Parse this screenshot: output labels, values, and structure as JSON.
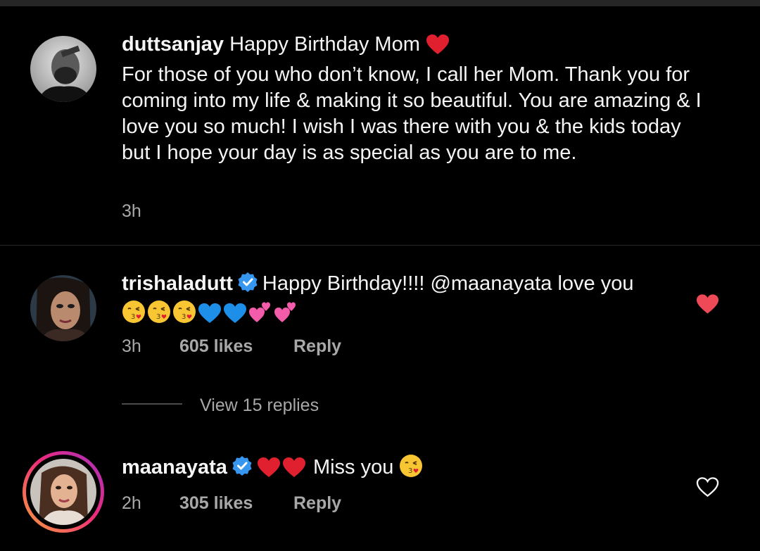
{
  "comments": [
    {
      "username": "duttsanjay",
      "text_first": "Happy Birthday Mom",
      "text_rest": "For those of you who don’t know, I call her Mom. Thank you for coming into my life & making it so beautiful. You are amazing & I love you so much! I wish I was there with you & the kids today but I hope your day is as special as you are to me.",
      "time": "3h",
      "verified": false
    },
    {
      "username": "trishaladutt",
      "text": "Happy Birthday!!!! @maanayata love you",
      "time": "3h",
      "likes": "605 likes",
      "reply_label": "Reply",
      "liked": true,
      "verified": true,
      "view_replies": "View 15 replies"
    },
    {
      "username": "maanayata",
      "text": "Miss you",
      "time": "2h",
      "likes": "305 likes",
      "reply_label": "Reply",
      "liked": false,
      "verified": true
    }
  ],
  "colors": {
    "background": "#000000",
    "text": "#f5f5f5",
    "muted": "#a8a8a8",
    "like_red": "#ed4956",
    "verified_blue": "#3797f0"
  },
  "icons": [
    "red-heart-emoji",
    "verified-badge-icon",
    "kissing-face-emoji",
    "blue-heart-emoji",
    "two-hearts-emoji",
    "heart-like-icon",
    "heart-outline-icon"
  ]
}
